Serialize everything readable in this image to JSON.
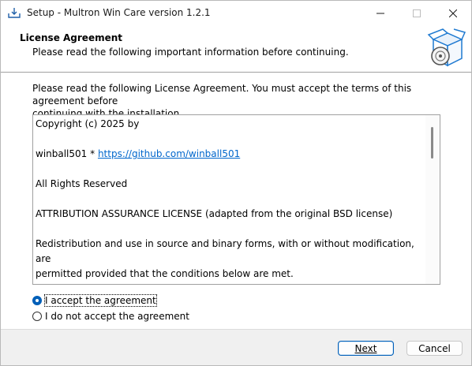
{
  "window": {
    "title": "Setup - Multron Win Care version 1.2.1"
  },
  "header": {
    "title": "License Agreement",
    "subtitle": "Please read the following important information before continuing."
  },
  "body": {
    "intro_line1": "Please read the following License Agreement. You must accept the terms of this agreement before",
    "intro_line2": "continuing with the installation.",
    "license": {
      "line1": "Copyright (c) 2025 by",
      "line2_prefix": "winball501 * ",
      "line2_link": "https://github.com/winball501",
      "line3": "All Rights Reserved",
      "line4": "ATTRIBUTION ASSURANCE LICENSE (adapted from the original BSD license)",
      "line5": "Redistribution and use in source and binary forms, with or without modification, are",
      "line6": "permitted provided that the conditions below are met."
    },
    "radio_accept": "I accept the agreement",
    "radio_decline": "I do not accept the agreement"
  },
  "footer": {
    "next_label": "Next",
    "cancel_label": "Cancel"
  },
  "colors": {
    "accent": "#005fb8",
    "link": "#0066cc"
  }
}
